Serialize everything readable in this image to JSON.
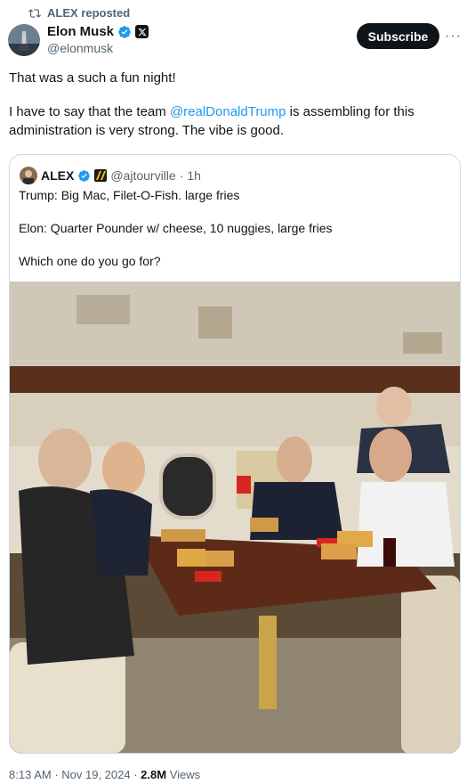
{
  "repost": {
    "label": "ALEX reposted"
  },
  "author": {
    "name": "Elon Musk",
    "handle": "@elonmusk"
  },
  "actions": {
    "subscribe": "Subscribe",
    "more": "···"
  },
  "tweet": {
    "line1": "That was a such a fun night!",
    "line2_pre": "I have to say that the team ",
    "line2_mention": "@realDonaldTrump",
    "line2_post": " is assembling for this administration is very strong. The vibe is good."
  },
  "quote": {
    "name": "ALEX",
    "handle": "@ajtourville",
    "dot": "·",
    "time": "1h",
    "line1": "Trump: Big Mac, Filet-O-Fish. large fries",
    "line2": "Elon: Quarter Pounder w/ cheese, 10 nuggies, large fries",
    "line3": "Which one do you go for?"
  },
  "meta": {
    "time": "8:13 AM",
    "sep1": " · ",
    "date": "Nov 19, 2024",
    "sep2": " · ",
    "views_count": "2.8M",
    "views_label": " Views"
  },
  "colors": {
    "link": "#1d9bf0",
    "verified": "#1d9bf0",
    "muted": "#536471",
    "text": "#0f1419"
  },
  "icons": [
    "repost-icon",
    "verified-icon",
    "x-logo-icon",
    "more-icon"
  ]
}
